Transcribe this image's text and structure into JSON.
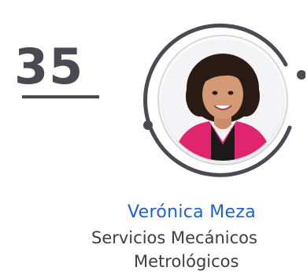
{
  "rank": "35",
  "person": {
    "name": "Verónica Meza",
    "company_line1": "Servicios Mecánicos",
    "company_line2": "Metrológicos"
  },
  "colors": {
    "rank": "#4a4a52",
    "name": "#1f5fd1",
    "company": "#3d3d44",
    "ring": "#4a4a52",
    "jacket": "#e0246e"
  },
  "icons": {
    "photo": "person-portrait"
  }
}
